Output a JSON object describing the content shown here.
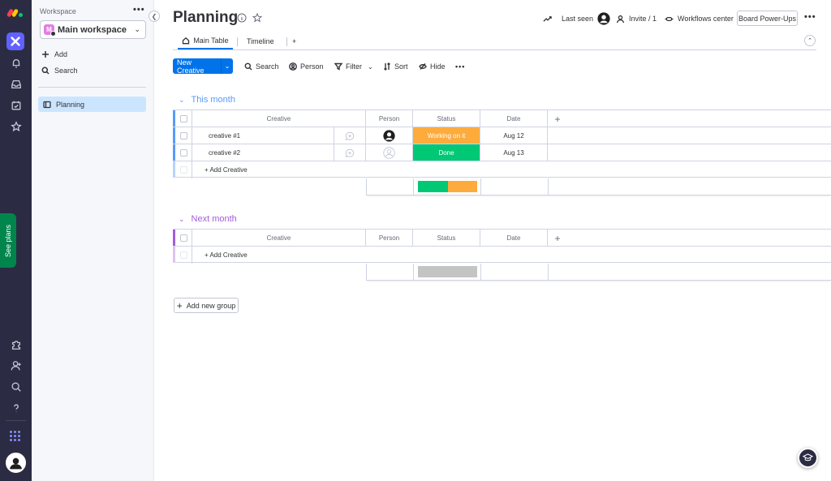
{
  "rail": {
    "see_plans": "See plans",
    "icons": [
      "monday-logo",
      "work-management-icon",
      "bell-icon",
      "inbox-icon",
      "my-work-icon",
      "star-icon",
      "puzzle-icon",
      "invite-user-icon",
      "search-icon",
      "help-icon",
      "apps-grid-icon",
      "avatar"
    ]
  },
  "sidebar": {
    "workspace_label": "Workspace",
    "more": "•••",
    "workspace_name": "Main workspace",
    "workspace_initial": "M",
    "add_label": "Add",
    "search_label": "Search",
    "board_name": "Planning"
  },
  "header": {
    "title": "Planning",
    "last_seen": "Last seen",
    "invite": "Invite / 1",
    "workflows": "Workflows center",
    "power_ups": "Board Power-Ups",
    "more": "•••"
  },
  "tabs": [
    {
      "label": "Main Table"
    },
    {
      "label": "Timeline"
    },
    {
      "label": "+"
    }
  ],
  "toolbar": {
    "new_item": "New Creative",
    "search": "Search",
    "person": "Person",
    "filter": "Filter",
    "sort": "Sort",
    "hide": "Hide",
    "more": "•••"
  },
  "columns": {
    "creative": "Creative",
    "person": "Person",
    "status": "Status",
    "date": "Date",
    "add": "+"
  },
  "groups": [
    {
      "title": "This month",
      "color": "#579bfc",
      "items": [
        {
          "name": "creative #1",
          "person": "assigned",
          "status": "Working on it",
          "status_color": "#fdab3d",
          "date": "Aug 12"
        },
        {
          "name": "creative #2",
          "person": "empty",
          "status": "Done",
          "status_color": "#00c875",
          "date": "Aug 13"
        }
      ],
      "add_item": "+ Add Creative",
      "summary": [
        {
          "color": "#00c875",
          "fraction": 0.5
        },
        {
          "color": "#fdab3d",
          "fraction": 0.5
        }
      ]
    },
    {
      "title": "Next month",
      "color": "#a25ddc",
      "items": [],
      "add_item": "+ Add Creative",
      "summary": [
        {
          "color": "#c4c4c4",
          "fraction": 1.0
        }
      ]
    }
  ],
  "add_group": "Add new group",
  "colors": {
    "primary": "#0073ea",
    "rail_bg": "#2b2c43",
    "sidebar_bg": "#f6f7fb",
    "selected_bg": "#cce5ff",
    "see_plans_bg": "#00854d"
  }
}
